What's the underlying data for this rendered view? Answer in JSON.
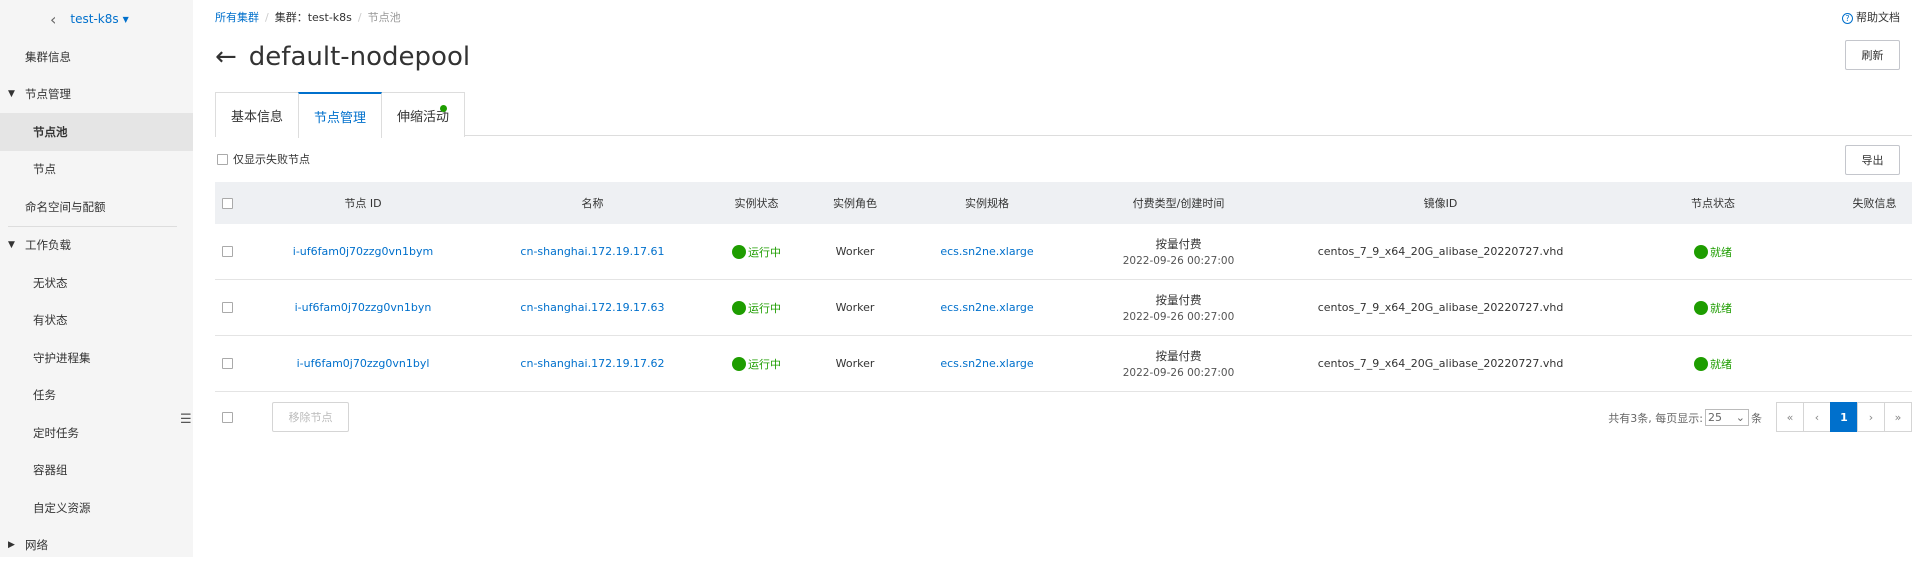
{
  "sidebar": {
    "cluster_name": "test-k8s",
    "items": [
      {
        "label": "集群信息"
      },
      {
        "label": "节点管理"
      },
      {
        "label": "节点池"
      },
      {
        "label": "节点"
      },
      {
        "label": "命名空间与配额"
      },
      {
        "label": "工作负载"
      },
      {
        "label": "无状态"
      },
      {
        "label": "有状态"
      },
      {
        "label": "守护进程集"
      },
      {
        "label": "任务"
      },
      {
        "label": "定时任务"
      },
      {
        "label": "容器组"
      },
      {
        "label": "自定义资源"
      },
      {
        "label": "网络"
      }
    ]
  },
  "breadcrumb": {
    "root": "所有集群",
    "cluster": "集群：test-k8s",
    "current": "节点池"
  },
  "help_label": "帮助文档",
  "page": {
    "title": "default-nodepool",
    "refresh_label": "刷新",
    "export_label": "导出"
  },
  "tabs": [
    {
      "label": "基本信息"
    },
    {
      "label": "节点管理"
    },
    {
      "label": "伸缩活动"
    }
  ],
  "filter_label": "仅显示失败节点",
  "table": {
    "headers": [
      "节点 ID",
      "名称",
      "实例状态",
      "实例角色",
      "实例规格",
      "付费类型/创建时间",
      "镜像ID",
      "节点状态",
      "失败信息"
    ],
    "rows": [
      {
        "node_id": "i-uf6fam0j70zzg0vn1bym",
        "name": "cn-shanghai.172.19.17.61",
        "instance_status": "运行中",
        "role": "Worker",
        "spec": "ecs.sn2ne.xlarge",
        "pay_type": "按量付费",
        "created": "2022-09-26 00:27:00",
        "image": "centos_7_9_x64_20G_alibase_20220727.vhd",
        "node_status": "就绪"
      },
      {
        "node_id": "i-uf6fam0j70zzg0vn1byn",
        "name": "cn-shanghai.172.19.17.63",
        "instance_status": "运行中",
        "role": "Worker",
        "spec": "ecs.sn2ne.xlarge",
        "pay_type": "按量付费",
        "created": "2022-09-26 00:27:00",
        "image": "centos_7_9_x64_20G_alibase_20220727.vhd",
        "node_status": "就绪"
      },
      {
        "node_id": "i-uf6fam0j70zzg0vn1byl",
        "name": "cn-shanghai.172.19.17.62",
        "instance_status": "运行中",
        "role": "Worker",
        "spec": "ecs.sn2ne.xlarge",
        "pay_type": "按量付费",
        "created": "2022-09-26 00:27:00",
        "image": "centos_7_9_x64_20G_alibase_20220727.vhd",
        "node_status": "就绪"
      }
    ]
  },
  "footer": {
    "remove_label": "移除节点",
    "total_text": "共有3条, 每页显示:",
    "page_size": "25",
    "unit": "条",
    "pager": [
      "«",
      "‹",
      "1",
      "›",
      "»"
    ]
  },
  "colors": {
    "accent": "#0070cc",
    "success": "#1e9d00"
  }
}
